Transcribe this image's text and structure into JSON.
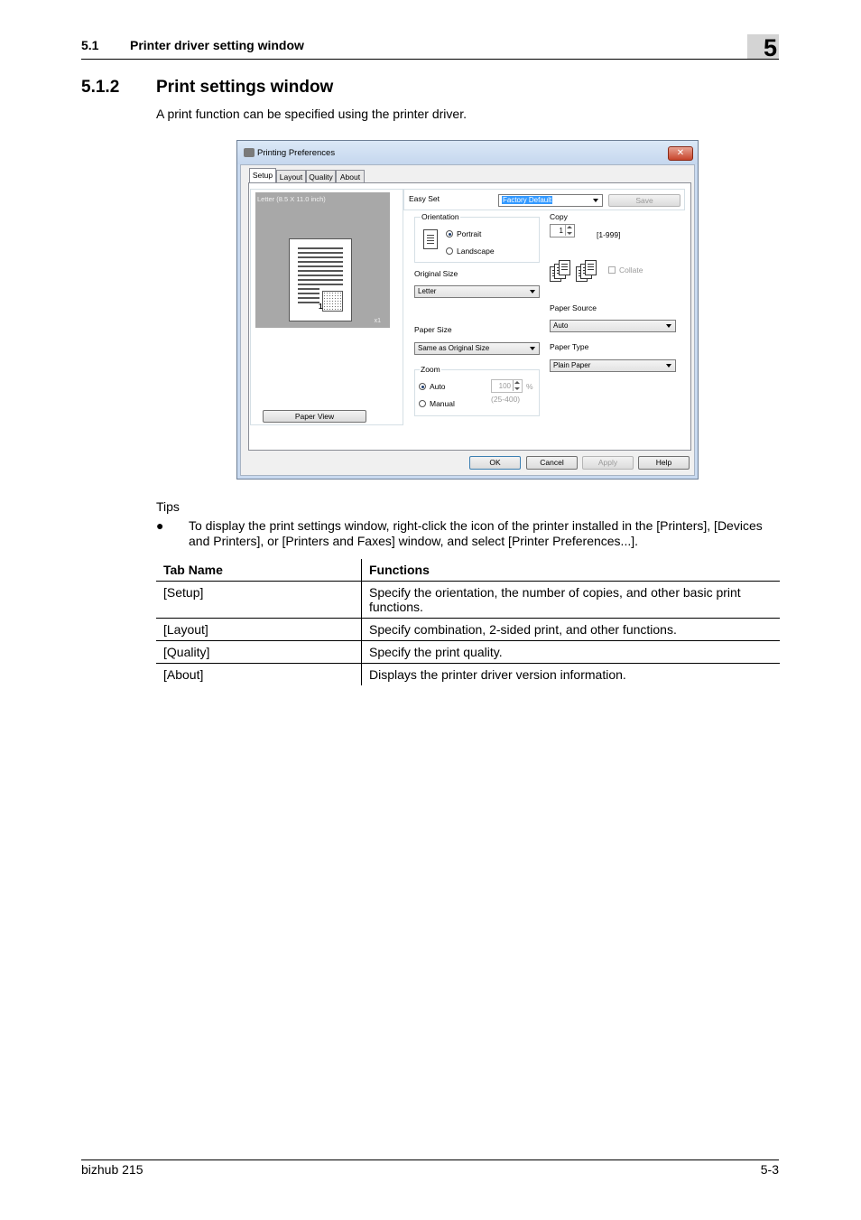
{
  "header": {
    "section_number": "5.1",
    "section_title": "Printer driver setting window",
    "chapter": "5"
  },
  "section": {
    "number": "5.1.2",
    "title": "Print settings window"
  },
  "intro": "A print function can be specified using the printer driver.",
  "dialog": {
    "title": "Printing Preferences",
    "close": "✕",
    "tabs": [
      "Setup",
      "Layout",
      "Quality",
      "About"
    ],
    "preview_label": "Letter (8.5 X 11.0 inch)",
    "preview_scale": "x1",
    "page_number": "1",
    "paper_view_button": "Paper View",
    "easy_set": {
      "label": "Easy Set",
      "value": "Factory Default",
      "save_button": "Save"
    },
    "orientation": {
      "label": "Orientation",
      "options": [
        "Portrait",
        "Landscape"
      ]
    },
    "original_size": {
      "label": "Original Size",
      "value": "Letter"
    },
    "paper_size": {
      "label": "Paper Size",
      "value": "Same as Original Size"
    },
    "zoom": {
      "label": "Zoom",
      "auto": "Auto",
      "manual": "Manual",
      "value": "100",
      "unit": "%",
      "range": "(25-400)"
    },
    "copy": {
      "label": "Copy",
      "value": "1",
      "range": "[1-999]",
      "collate": "Collate"
    },
    "paper_source": {
      "label": "Paper Source",
      "value": "Auto"
    },
    "paper_type": {
      "label": "Paper Type",
      "value": "Plain Paper"
    },
    "buttons": {
      "ok": "OK",
      "cancel": "Cancel",
      "apply": "Apply",
      "help": "Help"
    }
  },
  "tips": {
    "heading": "Tips",
    "bullet": "●",
    "text": "To display the print settings window, right-click the icon of the printer installed in the [Printers], [Devices and Printers], or [Printers and Faxes] window, and select [Printer Preferences...]."
  },
  "table": {
    "headers": [
      "Tab Name",
      "Functions"
    ],
    "rows": [
      [
        "[Setup]",
        "Specify the orientation, the number of copies, and other basic print functions."
      ],
      [
        "[Layout]",
        "Specify combination, 2-sided print, and other functions."
      ],
      [
        "[Quality]",
        "Specify the print quality."
      ],
      [
        "[About]",
        "Displays the printer driver version information."
      ]
    ]
  },
  "footer": {
    "left": "bizhub 215",
    "right": "5-3"
  }
}
